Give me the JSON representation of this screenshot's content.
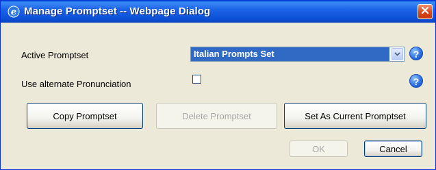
{
  "window": {
    "title": "Manage Promptset -- Webpage Dialog",
    "title_icon": "ie-icon",
    "close_icon": "close-icon"
  },
  "form": {
    "active_promptset_label": "Active Promptset",
    "active_promptset_value": "Italian Prompts Set",
    "alt_pronunciation_label": "Use alternate Pronunciation",
    "alt_pronunciation_checked": false,
    "help_glyph": "?"
  },
  "buttons": {
    "copy": "Copy Promptset",
    "delete": "Delete Promptset",
    "set_current": "Set As Current Promptset",
    "ok": "OK",
    "cancel": "Cancel"
  },
  "colors": {
    "titlebar": "#0b4fd4",
    "selection": "#316ac5",
    "dialog_bg": "#ece9d8"
  }
}
